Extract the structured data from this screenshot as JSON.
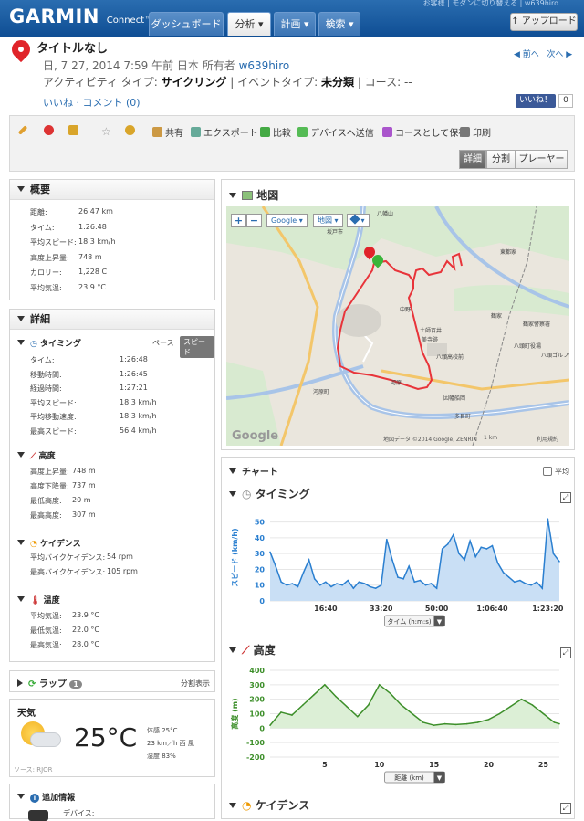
{
  "header": {
    "logo": "GARMIN",
    "logo_sub": "Connect",
    "logo_tm": "™",
    "nav": [
      "ダッシュボード",
      "分析",
      "計画",
      "検索"
    ],
    "toplinks": "お客様  |  モダンに切り替える  |  w639hiro",
    "upload": "↑ アップロード"
  },
  "activity": {
    "title": "タイトルなし",
    "date": "日, 7 27, 2014 7:59 午前 日本 所有者",
    "owner": "w639hiro",
    "type_label": "アクティビティ タイプ:",
    "type": "サイクリング",
    "event_label": "| イベントタイプ:",
    "event": "未分類",
    "course": "| コース: --",
    "social": "いいね · コメント (0)",
    "prev": "◀ 前へ",
    "next": "次へ ▶",
    "like": "いいね！",
    "like_count": "0"
  },
  "toolbar": {
    "items": [
      "",
      "",
      "",
      "",
      "",
      "共有",
      "エクスポート",
      "比較",
      "デバイスへ送信",
      "コースとして保存",
      "印刷"
    ],
    "views": [
      "詳細",
      "分割",
      "プレーヤー"
    ]
  },
  "summary": {
    "title": "概要",
    "rows": [
      [
        "距離:",
        "26.47 km"
      ],
      [
        "タイム:",
        "1:26:48"
      ],
      [
        "平均スピード:",
        "18.3 km/h"
      ],
      [
        "高度上昇量:",
        "748 m"
      ],
      [
        "カロリー:",
        "1,228 C"
      ],
      [
        "平均気温:",
        "23.9 °C"
      ]
    ]
  },
  "details": {
    "title": "詳細",
    "timing": {
      "title": "タイミング",
      "pace": "ペース",
      "speed": "スピード",
      "rows": [
        [
          "タイム:",
          "1:26:48"
        ],
        [
          "移動時間:",
          "1:26:45"
        ],
        [
          "経過時間:",
          "1:27:21"
        ],
        [
          "平均スピード:",
          "18.3 km/h"
        ],
        [
          "平均移動速度:",
          "18.3 km/h"
        ],
        [
          "最高スピード:",
          "56.4 km/h"
        ]
      ]
    },
    "elevation": {
      "title": "高度",
      "rows": [
        [
          "高度上昇量:",
          "748 m"
        ],
        [
          "高度下降量:",
          "737 m"
        ],
        [
          "最低高度:",
          "20 m"
        ],
        [
          "最高高度:",
          "307 m"
        ]
      ]
    },
    "cadence": {
      "title": "ケイデンス",
      "rows": [
        [
          "平均バイクケイデンス:",
          "54 rpm"
        ],
        [
          "最高バイクケイデンス:",
          "105 rpm"
        ]
      ]
    },
    "temp": {
      "title": "温度",
      "rows": [
        [
          "平均気温:",
          "23.9 °C"
        ],
        [
          "最低気温:",
          "22.0 °C"
        ],
        [
          "最高気温:",
          "28.0 °C"
        ]
      ]
    }
  },
  "laps": {
    "title": "ラップ",
    "count": "1",
    "split": "分割表示"
  },
  "weather": {
    "title": "天気",
    "temp": "25°C",
    "lines": [
      "体感 25°C",
      "23 km／h 西 風",
      "湿度 83%"
    ],
    "source": "ソース: RJOR"
  },
  "extra": {
    "title": "追加情報",
    "device": "デバイス:"
  },
  "map": {
    "title": "地図",
    "zoom_in": "+",
    "zoom_out": "−",
    "type_google": "Google ▾",
    "type_map": "地図 ▾",
    "layers": "▾",
    "credit": "地図データ ©2014 Google, ZENRIN",
    "scale": "1 km",
    "terms": "利用規約",
    "labels": [
      "八幡山",
      "坂戸市",
      "東都家",
      "鶴家",
      "鶴家警察署",
      "八頭町役場",
      "八頭ゴルフ倶楽部",
      "八頭高校前",
      "土師百井",
      "美寺跡",
      "中野",
      "河原",
      "因幡船岡",
      "多目町",
      "河原町"
    ],
    "google": "Google"
  },
  "charts": {
    "title": "チャート",
    "avg": "平均"
  },
  "chart_data": [
    {
      "type": "area",
      "title": "タイミング",
      "ylabel": "スピード (km/h)",
      "xlabel": "タイム (h:m:s)",
      "ylim": [
        0,
        55
      ],
      "xlim": [
        0,
        5208
      ],
      "yticks": [
        0,
        10,
        20,
        30,
        40,
        50
      ],
      "xticks": [
        "16:40",
        "33:20",
        "50:00",
        "1:06:40",
        "1:23:20"
      ],
      "xtick_values": [
        1000,
        2000,
        3000,
        4000,
        5000
      ],
      "x": [
        0,
        100,
        200,
        300,
        400,
        500,
        600,
        700,
        800,
        900,
        1000,
        1100,
        1200,
        1300,
        1400,
        1500,
        1600,
        1700,
        1800,
        1900,
        2000,
        2100,
        2200,
        2300,
        2400,
        2500,
        2600,
        2700,
        2800,
        2900,
        3000,
        3100,
        3200,
        3300,
        3400,
        3500,
        3600,
        3700,
        3800,
        3900,
        4000,
        4100,
        4200,
        4300,
        4400,
        4500,
        4600,
        4700,
        4800,
        4900,
        5000,
        5100,
        5208
      ],
      "y": [
        31,
        22,
        12,
        10,
        11,
        9,
        18,
        26,
        14,
        10,
        12,
        9,
        11,
        10,
        13,
        8,
        12,
        11,
        9,
        8,
        10,
        39,
        26,
        15,
        14,
        22,
        12,
        13,
        10,
        11,
        8,
        33,
        36,
        42,
        30,
        26,
        38,
        28,
        34,
        33,
        35,
        24,
        18,
        15,
        12,
        13,
        11,
        10,
        12,
        8,
        52,
        30,
        25
      ]
    },
    {
      "type": "area",
      "title": "高度",
      "ylabel": "高度 (m)",
      "xlabel": "距離 (km)",
      "ylim": [
        -200,
        400
      ],
      "xlim": [
        0,
        26.47
      ],
      "yticks": [
        -200,
        -100,
        0,
        100,
        200,
        300,
        400
      ],
      "xticks": [
        "5",
        "10",
        "15",
        "20",
        "25"
      ],
      "xtick_values": [
        5,
        10,
        15,
        20,
        25
      ],
      "x": [
        0,
        1,
        2,
        3,
        4,
        5,
        6,
        7,
        8,
        9,
        10,
        11,
        12,
        13,
        14,
        15,
        16,
        17,
        18,
        19,
        20,
        21,
        22,
        23,
        24,
        25,
        26,
        26.47
      ],
      "y": [
        20,
        110,
        90,
        160,
        230,
        300,
        220,
        150,
        80,
        160,
        300,
        240,
        160,
        100,
        40,
        20,
        30,
        25,
        30,
        40,
        60,
        100,
        150,
        200,
        160,
        100,
        40,
        30
      ]
    }
  ],
  "cadence_title": "ケイデンス",
  "colors": {
    "accent": "#2a6db0",
    "speed": "#2a7fd0",
    "speed_fill": "#c9dff5",
    "elev": "#3d8f2a",
    "elev_fill": "#dcefd6",
    "route": "#e8343a"
  }
}
